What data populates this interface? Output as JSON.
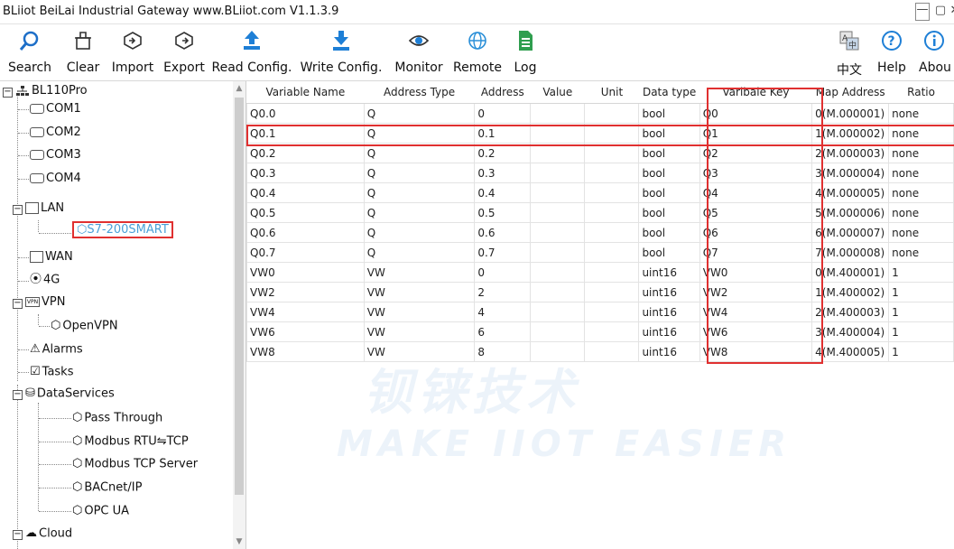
{
  "window": {
    "title": "BLiiot BeiLai Industrial Gateway www.BLiiot.com V1.1.3.9",
    "controls": [
      "—",
      "▢",
      "✕"
    ]
  },
  "toolbar": {
    "buttons": [
      {
        "label": "Search",
        "icon": "search-icon"
      },
      {
        "label": "Clear",
        "icon": "trash-icon"
      },
      {
        "label": "Import",
        "icon": "import-icon"
      },
      {
        "label": "Export",
        "icon": "export-icon"
      },
      {
        "label": "Read Config.",
        "icon": "upload-icon"
      },
      {
        "label": "Write Config.",
        "icon": "download-icon"
      },
      {
        "label": "Monitor",
        "icon": "eye-icon"
      },
      {
        "label": "Remote",
        "icon": "globe-icon"
      },
      {
        "label": "Log",
        "icon": "log-icon"
      },
      {
        "label": "中文",
        "icon": "language-icon"
      },
      {
        "label": "Help",
        "icon": "help-icon"
      },
      {
        "label": "Abou",
        "icon": "info-icon"
      }
    ]
  },
  "tree": {
    "root": "BL110Pro",
    "items": [
      "COM1",
      "COM2",
      "COM3",
      "COM4",
      "LAN",
      "S7-200SMART",
      "WAN",
      "4G",
      "VPN",
      "OpenVPN",
      "Alarms",
      "Tasks",
      "DataServices",
      "Pass Through",
      "Modbus RTU⇋TCP",
      "Modbus TCP Server",
      "BACnet/IP",
      "OPC UA",
      "Cloud"
    ]
  },
  "table": {
    "columns": [
      "Variable Name",
      "Address Type",
      "Address",
      "Value",
      "Unit",
      "Data type",
      "Varibale Key",
      "Map Address",
      "Ratio"
    ],
    "rows": [
      [
        "Q0.0",
        "Q",
        "0",
        "",
        "",
        "bool",
        "Q0",
        "0(M.000001)",
        "none"
      ],
      [
        "Q0.1",
        "Q",
        "0.1",
        "",
        "",
        "bool",
        "Q1",
        "1(M.000002)",
        "none"
      ],
      [
        "Q0.2",
        "Q",
        "0.2",
        "",
        "",
        "bool",
        "Q2",
        "2(M.000003)",
        "none"
      ],
      [
        "Q0.3",
        "Q",
        "0.3",
        "",
        "",
        "bool",
        "Q3",
        "3(M.000004)",
        "none"
      ],
      [
        "Q0.4",
        "Q",
        "0.4",
        "",
        "",
        "bool",
        "Q4",
        "4(M.000005)",
        "none"
      ],
      [
        "Q0.5",
        "Q",
        "0.5",
        "",
        "",
        "bool",
        "Q5",
        "5(M.000006)",
        "none"
      ],
      [
        "Q0.6",
        "Q",
        "0.6",
        "",
        "",
        "bool",
        "Q6",
        "6(M.000007)",
        "none"
      ],
      [
        "Q0.7",
        "Q",
        "0.7",
        "",
        "",
        "bool",
        "Q7",
        "7(M.000008)",
        "none"
      ],
      [
        "VW0",
        "VW",
        "0",
        "",
        "",
        "uint16",
        "VW0",
        "0(M.400001)",
        "1"
      ],
      [
        "VW2",
        "VW",
        "2",
        "",
        "",
        "uint16",
        "VW2",
        "1(M.400002)",
        "1"
      ],
      [
        "VW4",
        "VW",
        "4",
        "",
        "",
        "uint16",
        "VW4",
        "2(M.400003)",
        "1"
      ],
      [
        "VW6",
        "VW",
        "6",
        "",
        "",
        "uint16",
        "VW6",
        "3(M.400004)",
        "1"
      ],
      [
        "VW8",
        "VW",
        "8",
        "",
        "",
        "uint16",
        "VW8",
        "4(M.400005)",
        "1"
      ]
    ]
  },
  "watermark": {
    "cn": "钡铼技术",
    "en": "MAKE IIOT EASIER"
  },
  "colors": {
    "highlight": "#e03030",
    "selected_text": "#4aa0d8"
  }
}
